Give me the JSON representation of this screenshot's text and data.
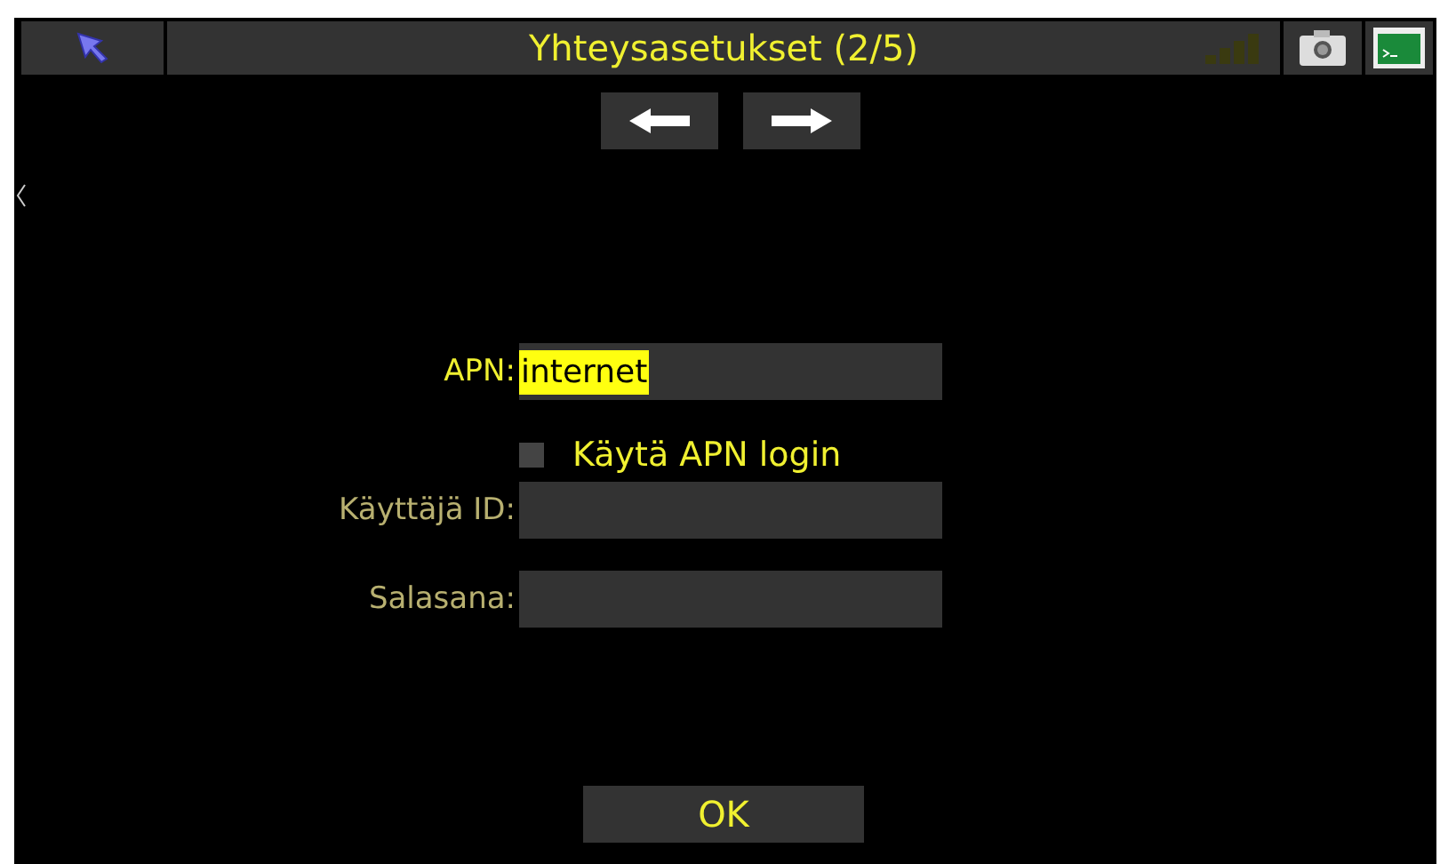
{
  "title_bar": {
    "title": "Yhteysasetukset (2/5)"
  },
  "nav_buttons": [
    {
      "kind": "back"
    },
    {
      "kind": "forward"
    }
  ],
  "fields": [
    {
      "label": "APN:",
      "value": "internet",
      "highlighted": true,
      "disabled": false
    },
    {
      "kind": "checkbox",
      "label": "Käytä APN login",
      "checked": false
    },
    {
      "label": "Käyttäjä ID:",
      "disabled": true
    },
    {
      "label": "Salasana:",
      "disabled": true
    }
  ],
  "ok_button": {
    "label": "OK"
  }
}
